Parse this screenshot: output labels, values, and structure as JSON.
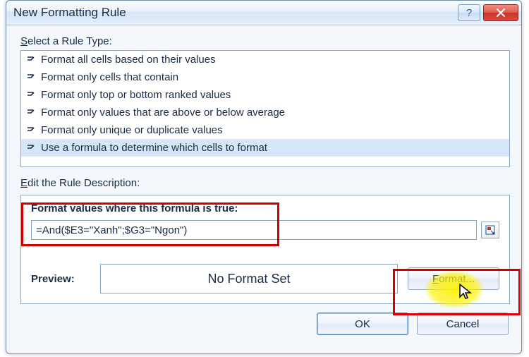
{
  "title": "New Formatting Rule",
  "select_label_pre": "S",
  "select_label_rest": "elect a Rule Type:",
  "rule_types": [
    "Format all cells based on their values",
    "Format only cells that contain",
    "Format only top or bottom ranked values",
    "Format only values that are above or below average",
    "Format only unique or duplicate values",
    "Use a formula to determine which cells to format"
  ],
  "edit_label_pre": "E",
  "edit_label_rest": "dit the Rule Description:",
  "formula_header_pre": "F",
  "formula_header_u": "o",
  "formula_header_post": "rmat values where this formula is true:",
  "formula_value": "=And($E3=\"Xanh\";$G3=\"Ngon\")",
  "preview_label": "Preview:",
  "preview_value": "No Format Set",
  "format_button_u": "F",
  "format_button_rest": "ormat...",
  "ok_label": "OK",
  "cancel_label": "Cancel"
}
